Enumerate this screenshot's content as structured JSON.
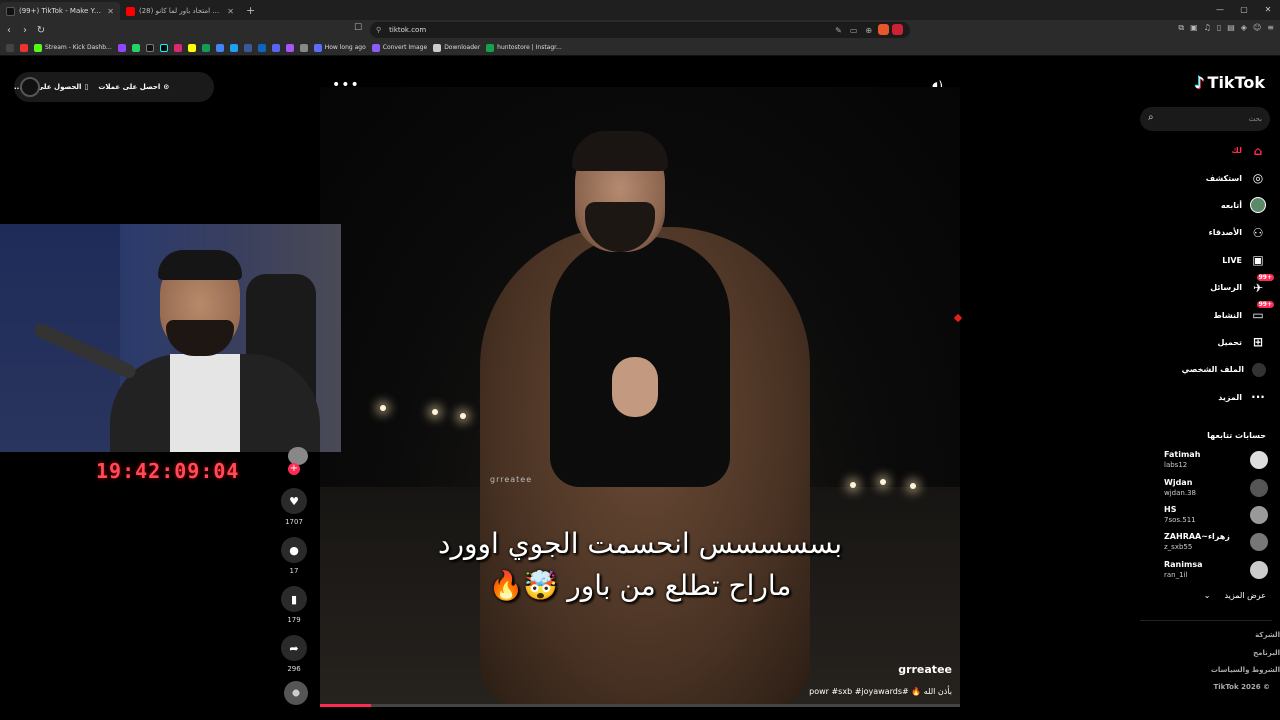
{
  "browser": {
    "tabs": [
      {
        "title": "(99+) TikTok - Make Your Day",
        "active": true
      },
      {
        "title": "(28) حلقت اسالتي امتحاد باور لما كانو ...",
        "active": false
      }
    ],
    "new_tab": "+",
    "address": "tiktok.com",
    "bookmarks": [
      "Stream - Kick Dashb...",
      "How long ago",
      "Convert Image",
      "Downloader",
      "huntostore | Instagr..."
    ]
  },
  "top_pill": {
    "item1": "احصل على عملات",
    "item2": "الحصول على الت..."
  },
  "more_dots": "•••",
  "video": {
    "watermark": "grreatee",
    "caption_line1": "بسسسسس انحسمت الجوي اوورد",
    "caption_line2": "ماراح تطلع من باور 🤯🔥",
    "author": "grreatee",
    "description": "بأذن الله 🔥 #powr #sxb #joyawards",
    "progress": 0.08
  },
  "webcam": {
    "clock": "19:42:09:04"
  },
  "actions": {
    "likes": "1707",
    "comments": "17",
    "saves": "179",
    "shares": "296"
  },
  "sidebar": {
    "logo": "TikTok",
    "search_placeholder": "بحث",
    "nav": [
      {
        "label": "لك",
        "icon": "home-icon"
      },
      {
        "label": "استكشف",
        "icon": "compass-icon"
      },
      {
        "label": "أتابعه",
        "icon": "avatar-icon"
      },
      {
        "label": "الأصدقاء",
        "icon": "friends-icon"
      },
      {
        "label": "LIVE",
        "icon": "live-icon"
      },
      {
        "label": "الرسائل",
        "icon": "message-icon",
        "badge": "99+"
      },
      {
        "label": "النشاط",
        "icon": "activity-icon",
        "badge": "99+"
      },
      {
        "label": "تحميل",
        "icon": "upload-icon"
      },
      {
        "label": "الملف الشخصي",
        "icon": "profile-icon"
      },
      {
        "label": "المزيد",
        "icon": "more-icon"
      }
    ],
    "following_title": "حسابات تتابعها",
    "accounts": [
      {
        "name": "Fatimah",
        "handle": "labs12"
      },
      {
        "name": "Wjdan",
        "handle": "wjdan.38"
      },
      {
        "name": "HS",
        "handle": "7sos.511"
      },
      {
        "name": "ZAHRAA~زهراء",
        "handle": "z_sxb55"
      },
      {
        "name": "Ranimsa",
        "handle": "ran_1il"
      }
    ],
    "see_more": "عرض المزيد",
    "footer": [
      "الشركة",
      "البرنامج",
      "الشروط والسياسات",
      "© 2026 TikTok"
    ]
  }
}
